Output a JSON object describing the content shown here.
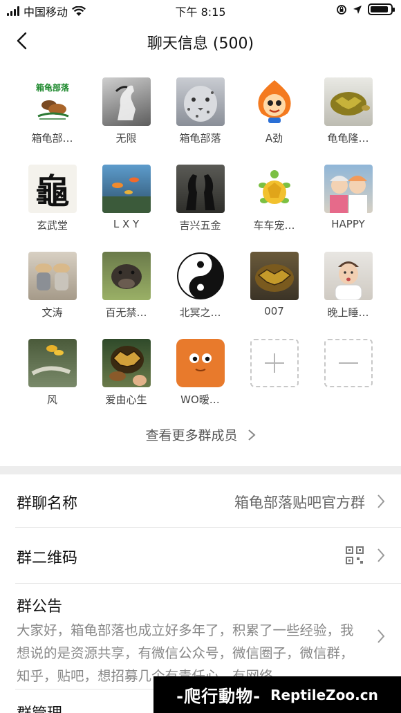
{
  "status_bar": {
    "carrier": "中国移动",
    "time": "下午 8:15",
    "battery_level": 0.9
  },
  "nav": {
    "title": "聊天信息 (500)",
    "back_icon": "chevron-left-icon"
  },
  "members": [
    {
      "name": "箱龟部…",
      "avatar_text": "箱龟部落"
    },
    {
      "name": "无限"
    },
    {
      "name": "箱龟部落"
    },
    {
      "name": "A劲"
    },
    {
      "name": "龟龟隆…"
    },
    {
      "name": "玄武堂",
      "avatar_text": "龜"
    },
    {
      "name": "L X Y"
    },
    {
      "name": "吉兴五金"
    },
    {
      "name": "车车宠…"
    },
    {
      "name": "HAPPY"
    },
    {
      "name": "文涛"
    },
    {
      "name": "百无禁…"
    },
    {
      "name": "北冥之…"
    },
    {
      "name": "007"
    },
    {
      "name": "晚上睡…"
    },
    {
      "name": "风"
    },
    {
      "name": "爱由心生"
    },
    {
      "name": "WO暧…"
    }
  ],
  "actions": {
    "add_icon": "plus-icon",
    "remove_icon": "minus-icon",
    "view_more": "查看更多群成员"
  },
  "settings": {
    "group_name_label": "群聊名称",
    "group_name_value": "箱龟部落贴吧官方群",
    "qr_label": "群二维码",
    "qr_icon": "qr-code-icon",
    "notice_label": "群公告",
    "notice_text": "大家好，箱龟部落也成立好多年了，积累了一些经验，我想说的是资源共享，有微信公众号，微信圈子，微信群，知乎，贴吧，想招募几个有责任心，有网络",
    "next_label": "群管理"
  },
  "watermark": {
    "cn": "-爬行動物-",
    "en": "ReptileZoo.cn"
  },
  "colors": {
    "background": "#ffffff",
    "band": "#ededed",
    "secondary_text": "#888888"
  }
}
